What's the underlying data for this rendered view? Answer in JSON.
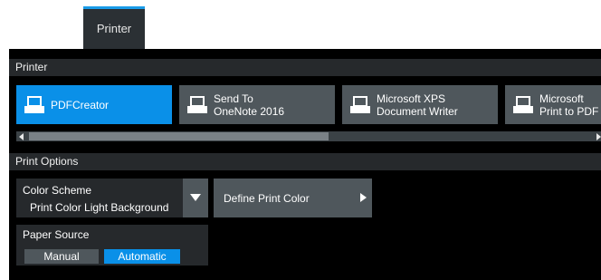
{
  "tab": {
    "label": "Printer"
  },
  "printer_section": {
    "header": "Printer",
    "printers": [
      {
        "label": "PDFCreator",
        "active": true
      },
      {
        "label": "Send To\nOneNote 2016",
        "active": false
      },
      {
        "label": "Microsoft XPS\nDocument Writer",
        "active": false
      },
      {
        "label": "Microsoft\nPrint to PDF",
        "active": false
      }
    ]
  },
  "print_options": {
    "header": "Print Options",
    "color_scheme": {
      "label": "Color Scheme",
      "value": "Print Color Light Background"
    },
    "define_color": {
      "label": "Define Print Color"
    },
    "paper_source": {
      "label": "Paper Source",
      "options": [
        "Manual",
        "Automatic"
      ],
      "selected": "Automatic"
    }
  },
  "colors": {
    "accent": "#0a90e8",
    "button": "#4f575c",
    "panel": "#000000",
    "section": "#26292c"
  }
}
